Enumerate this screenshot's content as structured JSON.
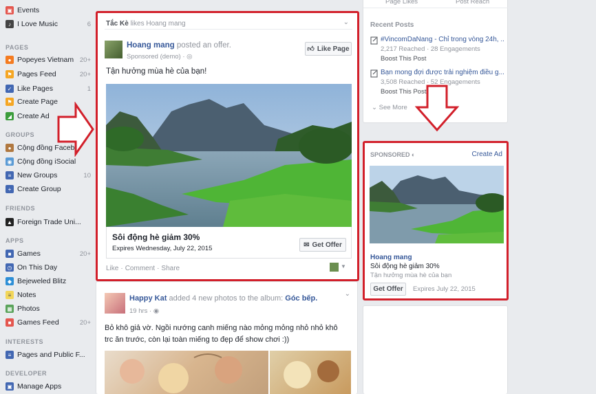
{
  "sidebar": {
    "items_top": [
      {
        "label": "Events",
        "count": ""
      },
      {
        "label": "I Love Music",
        "count": "6"
      }
    ],
    "pages_heading": "PAGES",
    "pages": [
      {
        "label": "Popeyes Vietnam",
        "count": "20+"
      },
      {
        "label": "Pages Feed",
        "count": "20+"
      },
      {
        "label": "Like Pages",
        "count": "1"
      },
      {
        "label": "Create Page",
        "count": ""
      },
      {
        "label": "Create Ad",
        "count": ""
      }
    ],
    "groups_heading": "GROUPS",
    "groups": [
      {
        "label": "Cộng đồng Facebo",
        "count": ""
      },
      {
        "label": "Cộng đồng iSocial",
        "count": ""
      },
      {
        "label": "New Groups",
        "count": "10"
      },
      {
        "label": "Create Group",
        "count": ""
      }
    ],
    "friends_heading": "FRIENDS",
    "friends": [
      {
        "label": "Foreign Trade Uni...",
        "count": ""
      }
    ],
    "apps_heading": "APPS",
    "apps": [
      {
        "label": "Games",
        "count": "20+"
      },
      {
        "label": "On This Day",
        "count": ""
      },
      {
        "label": "Bejeweled Blitz",
        "count": ""
      },
      {
        "label": "Notes",
        "count": ""
      },
      {
        "label": "Photos",
        "count": ""
      },
      {
        "label": "Games Feed",
        "count": "20+"
      }
    ],
    "interests_heading": "INTERESTS",
    "interests": [
      {
        "label": "Pages and Public F...",
        "count": ""
      }
    ],
    "developer_heading": "DEVELOPER",
    "developer": [
      {
        "label": "Manage Apps",
        "count": ""
      }
    ]
  },
  "post1": {
    "header_liker": "Tắc Kè",
    "header_rest": "likes Hoang mang",
    "author": "Hoang mang",
    "action": "posted an offer.",
    "meta": "Sponsored (demo) ·",
    "like_page": "Like Page",
    "text": "Tận hưởng mùa hè của bạn!",
    "offer_title": "Sôi động hè giảm 30%",
    "offer_expires": "Expires Wednesday, July 22, 2015",
    "get_offer": "Get Offer",
    "actions": [
      "Like",
      "Comment",
      "Share"
    ]
  },
  "post2": {
    "author": "Happy Kat",
    "action": "added 4 new photos to the album:",
    "album": "Góc bếp.",
    "meta": "19 hrs ·",
    "text": "Bỏ khô giả vờ. Ngồi nướng canh miếng nào mỏng mỏng nhỏ nhỏ khô trc ăn trước, còn lại toàn miếng to đẹp để show chơi :))"
  },
  "right": {
    "top_tabs": [
      "Page Likes",
      "Post Reach"
    ],
    "recent_heading": "Recent Posts",
    "recent": [
      {
        "title": "#VincomDaNang - Chỉ trong vòng 24h, ...",
        "stats": "2,217 Reached · 28 Engagements",
        "boost": "Boost This Post"
      },
      {
        "title": "Bạn mong đợi được trải nghiệm điều g...",
        "stats": "3,508 Reached · 52 Engagements",
        "boost": "Boost This Post"
      }
    ],
    "see_more": "See More",
    "sponsored_label": "SPONSORED",
    "create_ad": "Create Ad",
    "ad_name": "Hoang mang",
    "ad_offer": "Sôi động hè giảm 30%",
    "ad_text": "Tận hưởng mùa hè của bạn",
    "ad_button": "Get Offer",
    "ad_expires": "Expires July 22, 2015"
  },
  "colors": {
    "highlight_red": "#d21f2a",
    "link_blue": "#365899"
  }
}
